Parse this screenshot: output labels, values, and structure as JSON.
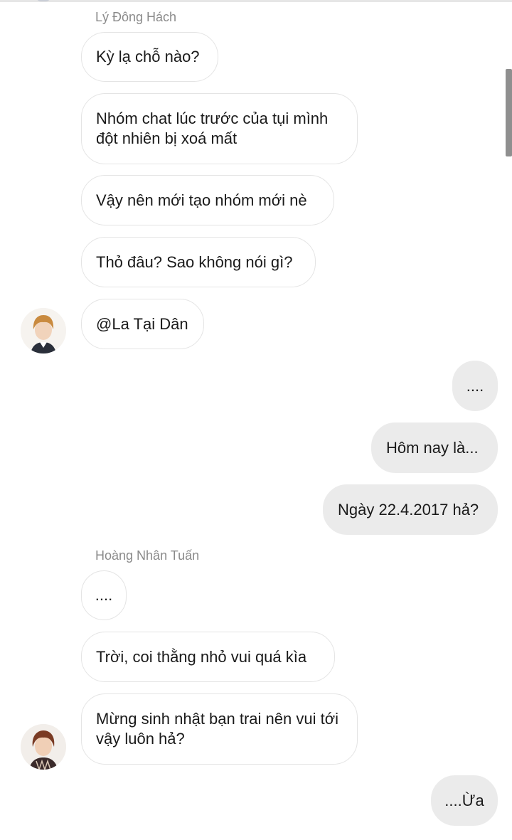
{
  "conversation": {
    "group1": {
      "sender": "Lý Đông Hách",
      "messages": [
        "Kỳ lạ chỗ nào?",
        "Nhóm chat lúc trước của tụi mình đột nhiên bị xoá mất",
        "Vậy nên mới tạo nhóm mới nè",
        "Thỏ đâu? Sao không nói gì?",
        "@La Tại Dân"
      ]
    },
    "outgoing1": {
      "messages": [
        "....",
        "Hôm nay là...",
        "Ngày 22.4.2017 hả?"
      ]
    },
    "group2": {
      "sender": "Hoàng Nhân Tuấn",
      "messages": [
        "....",
        "Trời, coi thằng nhỏ vui quá kìa",
        "Mừng sinh nhật bạn trai nên vui tới vậy luôn hả?"
      ]
    },
    "outgoing2": {
      "messages": [
        "....Ừa"
      ]
    }
  },
  "colors": {
    "incoming_bubble": "#ffffff",
    "incoming_border": "#e4e4e4",
    "outgoing_bubble": "#ebebeb",
    "sender_name": "#8a8a8a",
    "text": "#1a1a1a"
  }
}
